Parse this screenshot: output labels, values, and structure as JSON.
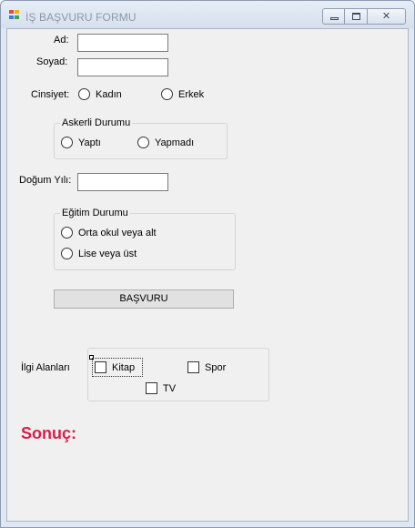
{
  "window": {
    "title": "İŞ BAŞVURU FORMU",
    "controls": {
      "minimize": "minimize",
      "maximize": "maximize",
      "close": "✕"
    }
  },
  "form": {
    "ad_label": "Ad:",
    "soyad_label": "Soyad:",
    "cinsiyet_label": "Cinsiyet:",
    "cinsiyet_options": [
      "Kadın",
      "Erkek"
    ],
    "askerlik": {
      "title": "Askerli Durumu",
      "options": [
        "Yaptı",
        "Yapmadı"
      ]
    },
    "dogum_yili_label": "Doğum Yılı:",
    "egitim": {
      "title": "Eğitim Durumu",
      "options": [
        "Orta okul veya alt",
        "Lise veya üst"
      ]
    },
    "submit_label": "BAŞVURU",
    "ilgi_label": "İlgi Alanları",
    "ilgi_options": [
      "Kitap",
      "Spor",
      "TV"
    ],
    "result_label": "Sonuç:"
  },
  "colors": {
    "result": "#d81e4b",
    "title_text": "#8a98ab"
  },
  "icons": {
    "app": "windows-form-icon"
  }
}
